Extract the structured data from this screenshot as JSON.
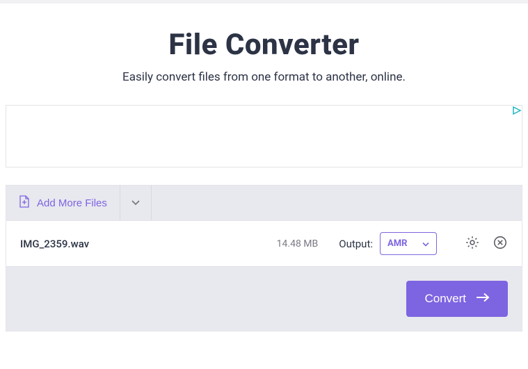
{
  "header": {
    "title": "File Converter",
    "subtitle": "Easily convert files from one format to another, online."
  },
  "toolbar": {
    "add_more_label": "Add More Files"
  },
  "file": {
    "name": "IMG_2359.wav",
    "size": "14.48 MB",
    "output_label": "Output:",
    "output_format": "AMR"
  },
  "actions": {
    "convert_label": "Convert"
  }
}
